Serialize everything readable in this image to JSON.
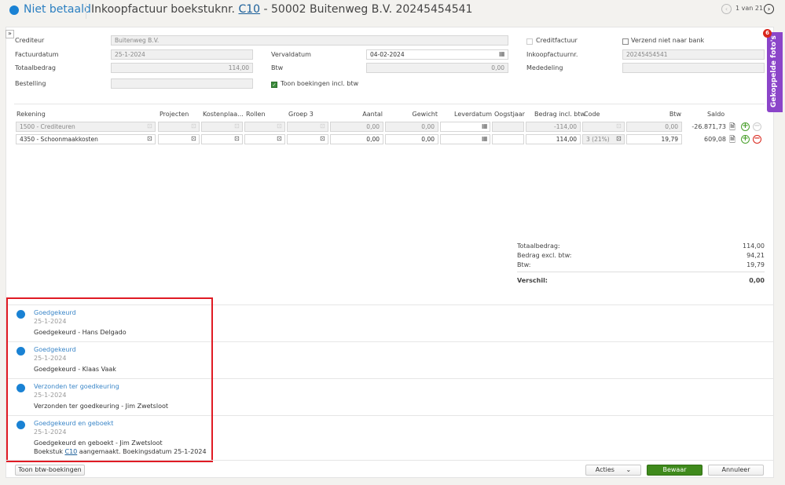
{
  "header": {
    "status": "Niet betaald",
    "title_prefix": "Inkoopfactuur boekstuknr.",
    "doc_link": "C10",
    "title_suffix": " - 50002 Buitenweg B.V. 20245454541",
    "pager": "1 van 21",
    "status_color": "#1a82d4"
  },
  "form": {
    "crediteur_label": "Crediteur",
    "crediteur": "Buitenweg B.V.",
    "factuurdatum_label": "Factuurdatum",
    "factuurdatum": "25-1-2024",
    "vervaldatum_label": "Vervaldatum",
    "vervaldatum": "04-02-2024",
    "totaalbedrag_label": "Totaalbedrag",
    "totaalbedrag": "114,00",
    "btw_label": "Btw",
    "btw": "0,00",
    "bestelling_label": "Bestelling",
    "bestelling": "",
    "toon_incl_label": "Toon boekingen incl. btw",
    "toon_incl_checked": true,
    "creditfactuur_label": "Creditfactuur",
    "creditfactuur_checked": false,
    "verzend_label": "Verzend niet naar bank",
    "verzend_checked": false,
    "inkoopnr_label": "Inkoopfactuurnr.",
    "inkoopnr": "20245454541",
    "mededeling_label": "Mededeling",
    "mededeling": ""
  },
  "side_tab": {
    "label": "Gekoppelde foto's",
    "badge": "6",
    "color": "#8b45c9"
  },
  "table": {
    "headers": [
      "Rekening",
      "Projecten",
      "Kostenplaa...",
      "Rollen",
      "Groep 3",
      "Aantal",
      "Gewicht",
      "Leverdatum",
      "Oogstjaar",
      "Bedrag incl. btw",
      "Code",
      "Btw",
      "Saldo"
    ],
    "rows": [
      {
        "rekening": "1500 - Crediteuren",
        "aantal": "0,00",
        "gewicht": "0,00",
        "bedrag": "-114,00",
        "code": "",
        "btw": "0,00",
        "saldo": "-26.871,73"
      },
      {
        "rekening": "4350 - Schoonmaakkosten",
        "aantal": "0,00",
        "gewicht": "0,00",
        "bedrag": "114,00",
        "code": "3 (21%)",
        "btw": "19,79",
        "saldo": "609,08"
      }
    ]
  },
  "totals": {
    "totaal_label": "Totaalbedrag:",
    "totaal": "114,00",
    "excl_label": "Bedrag excl. btw:",
    "excl": "94,21",
    "btw_label": "Btw:",
    "btw": "19,79",
    "verschil_label": "Verschil:",
    "verschil": "0,00"
  },
  "timeline": [
    {
      "title": "Goedgekeurd",
      "date": "25-1-2024",
      "text": "Goedgekeurd - Hans Delgado"
    },
    {
      "title": "Goedgekeurd",
      "date": "25-1-2024",
      "text": "Goedgekeurd - Klaas Vaak"
    },
    {
      "title": "Verzonden ter goedkeuring",
      "date": "25-1-2024",
      "text": "Verzonden ter goedkeuring - Jim Zwetsloot"
    },
    {
      "title": "Goedgekeurd en geboekt",
      "date": "25-1-2024",
      "text": "Goedgekeurd en geboekt - Jim Zwetsloot",
      "extra_prefix": "Boekstuk ",
      "extra_link": "C10",
      "extra_suffix": " aangemaakt. Boekingsdatum 25-1-2024"
    }
  ],
  "footer": {
    "toon_btw": "Toon btw-boekingen",
    "acties": "Acties",
    "bewaar": "Bewaar",
    "annuleer": "Annuleer",
    "bewaar_color": "#3f8a1c"
  }
}
